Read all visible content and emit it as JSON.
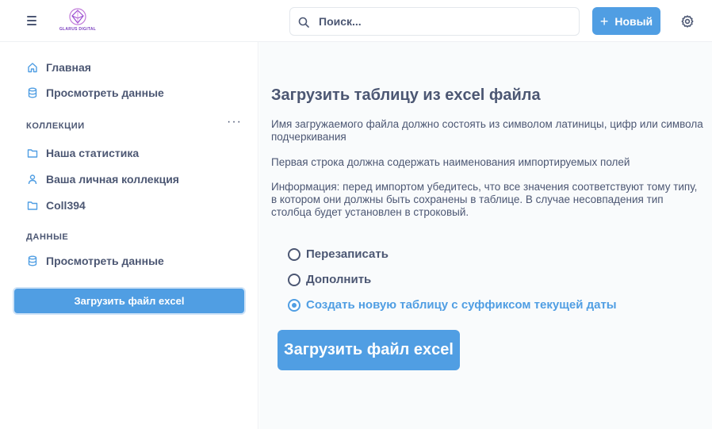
{
  "header": {
    "logo_text": "GLARUS DIGITAL",
    "search_placeholder": "Поиск...",
    "new_button": "Новый",
    "new_button_icon": "plus-icon"
  },
  "sidebar": {
    "home": "Главная",
    "browse_data": "Просмотреть данные",
    "collections_title": "КОЛЛЕКЦИИ",
    "collections_more": "···",
    "collections": [
      {
        "label": "Наша статистика",
        "icon": "folder-icon"
      },
      {
        "label": "Ваша личная коллекция",
        "icon": "person-icon"
      },
      {
        "label": "Coll394",
        "icon": "folder-icon"
      }
    ],
    "data_title": "ДАННЫЕ",
    "data_browse": "Просмотреть данные",
    "upload_button": "Загрузить файл excel"
  },
  "main": {
    "title": "Загрузить таблицу из excel файла",
    "note1": "Имя загружаемого файла должно состоять из символом латиницы, цифр или символа подчеркивания",
    "note2": "Первая строка должна содержать наименования импортируемых полей",
    "note3": "Информация: перед импортом убедитесь, что все значения соответствуют тому типу, в котором они должны быть сохранены в таблице. В случае несовпадения тип столбца будет установлен в строковый.",
    "options": [
      {
        "label": "Перезаписать",
        "selected": false
      },
      {
        "label": "Дополнить",
        "selected": false
      },
      {
        "label": "Создать новую таблицу с суффиксом текущей даты",
        "selected": true
      }
    ],
    "upload_button": "Загрузить файл excel"
  },
  "colors": {
    "accent": "#509ee3",
    "text": "#4c5773",
    "main_bg": "#f9fbfc"
  }
}
